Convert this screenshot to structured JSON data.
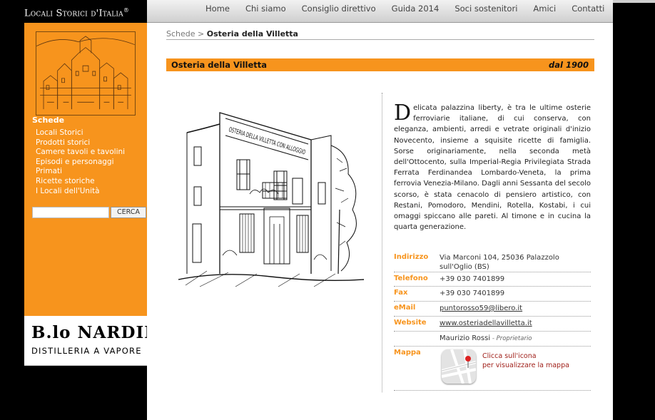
{
  "brand": {
    "title": "Locali Storici d'Italia",
    "registered": "®"
  },
  "nav": {
    "items": [
      "Home",
      "Chi siamo",
      "Consiglio direttivo",
      "Guida 2014",
      "Soci sostenitori",
      "Amici",
      "Contatti"
    ]
  },
  "sidebar": {
    "heading": "Schede",
    "items": [
      "Locali Storici",
      "Prodotti storici",
      "Camere tavoli e tavolini",
      "Episodi e personaggi",
      "Primati",
      "Ricette storiche",
      "I Locali dell'Unità"
    ],
    "search_placeholder": "",
    "search_button": "CERCA"
  },
  "sponsor": {
    "line1": "B.lo NARDINI",
    "line2": "DISTILLERIA A VAPORE"
  },
  "breadcrumb": {
    "parent": "Schede",
    "separator": " > ",
    "current": "Osteria della Villetta"
  },
  "page": {
    "title": "Osteria della Villetta",
    "since": "dal 1900",
    "sign_text": "OSTERIA DELLA VILLETTA CON ALLOGGIO"
  },
  "description": {
    "dropcap": "D",
    "text": "elicata palazzina liberty, è tra le ultime osterie ferroviarie italiane, di cui conserva, con eleganza, ambienti, arredi e vetrate originali d'inizio Novecento, insieme a squisite ricette di famiglia. Sorse originariamente, nella seconda metà dell'Ottocento, sulla Imperial-Regia Privilegiata Strada Ferrata Ferdinandea Lombardo-Veneta, la prima ferrovia Venezia-Milano. Dagli anni Sessanta del secolo scorso, è stata cenacolo di pensiero artistico, con Restani, Pomodoro, Mendini, Rotella, Kostabi, i cui omaggi spiccano alle pareti. Al timone e in cucina la quarta generazione."
  },
  "info": {
    "address_label": "Indirizzo",
    "address": "Via Marconi 104, 25036 Palazzolo sull'Oglio (BS)",
    "phone_label": "Telefono",
    "phone": "+39 030 7401899",
    "fax_label": "Fax",
    "fax": "+39 030 7401899",
    "email_label": "eMail",
    "email": "puntorosso59@libero.it",
    "website_label": "Website",
    "website": "www.osteriadellavilletta.it",
    "owner": "Maurizio Rossi",
    "owner_sep": " - ",
    "owner_role": "Proprietario",
    "map_label": "Mappa",
    "map_text_1": "Clicca sull'icona",
    "map_text_2": "per visualizzare la mappa"
  },
  "colors": {
    "accent": "#f7941d",
    "link_red": "#a0201a"
  }
}
